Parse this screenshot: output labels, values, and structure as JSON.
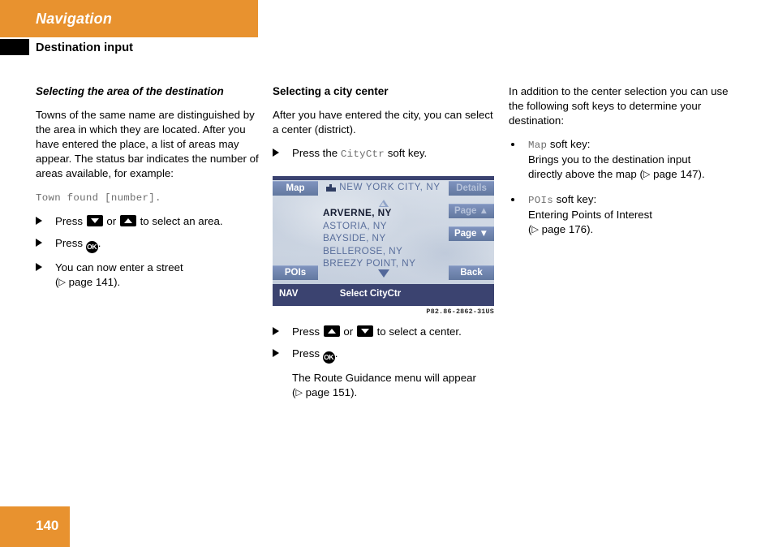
{
  "header": {
    "chapter": "Navigation",
    "section": "Destination input"
  },
  "left_column": {
    "title": "Selecting the area of the destination",
    "paragraph": "Towns of the same name are distinguished by the area in which they are located. After you have entered the place, a list of areas may appear. The status bar indicates the number of areas available, for example:",
    "example_code": "Town found [number].",
    "steps": [
      {
        "pre": "Press ",
        "key1": "down-arrow-key",
        "mid": " or ",
        "key2": "up-arrow-key",
        "post": " to select an area."
      },
      {
        "pre": "Press ",
        "key1": "ok-key",
        "post": "."
      }
    ],
    "step_street_line1": "You can now enter a street",
    "step_street_ref": "page 141",
    "ok_key_label": "OK"
  },
  "middle_column": {
    "title": "Selecting a city center",
    "paragraph": "After you have entered the city, you can select a center (district).",
    "step_softkey_pre": "Press the ",
    "step_softkey_mono": "CityCtr",
    "step_softkey_post": " soft key.",
    "steps_below": {
      "select_center_pre": "Press ",
      "select_center_mid": " or ",
      "select_center_post": " to select a center.",
      "press_ok_pre": "Press ",
      "press_ok_post": ".",
      "result_line1": "The Route Guidance menu will appear",
      "result_ref": "page 151"
    },
    "figure_code": "P82.86-2862-31US"
  },
  "nav_screen": {
    "soft_keys": {
      "map": "Map",
      "pois": "POIs",
      "details": "Details",
      "page_up": "Page ▲",
      "page_down": "Page ▼",
      "back": "Back"
    },
    "header_city": "NEW YORK CITY, NY",
    "city_icon": "city-buildings-icon",
    "list_items": [
      {
        "label": "ARVERNE, NY",
        "selected": true
      },
      {
        "label": "ASTORIA, NY",
        "selected": false
      },
      {
        "label": "BAYSIDE, NY",
        "selected": false
      },
      {
        "label": "BELLEROSE, NY",
        "selected": false
      },
      {
        "label": "BREEZY POINT, NY",
        "selected": false
      }
    ],
    "status_left": "NAV",
    "status_action": "Select CityCtr",
    "colors": {
      "screen_bg": "#c9d3e0",
      "soft_key": "#6d83ab",
      "status_bar": "#3b4370",
      "text_blue": "#5a6f9c",
      "selected_text": "#161d33"
    }
  },
  "right_column": {
    "intro": "In addition to the center selection you can use the following soft keys to determine your destination:",
    "bullets": [
      {
        "mono": "Map",
        "suffix": " soft key:",
        "line1": "Brings you to the destination input",
        "line2_pre": "directly above the map (",
        "ref": "page 147",
        "line2_post": ")."
      },
      {
        "mono": "POIs",
        "suffix": " soft key:",
        "line1": "Entering Points of Interest",
        "line2_pre": "(",
        "ref": "page 176",
        "line2_post": ")."
      }
    ]
  },
  "footer": {
    "page_number": "140",
    "accent_color": "#e8922f"
  }
}
